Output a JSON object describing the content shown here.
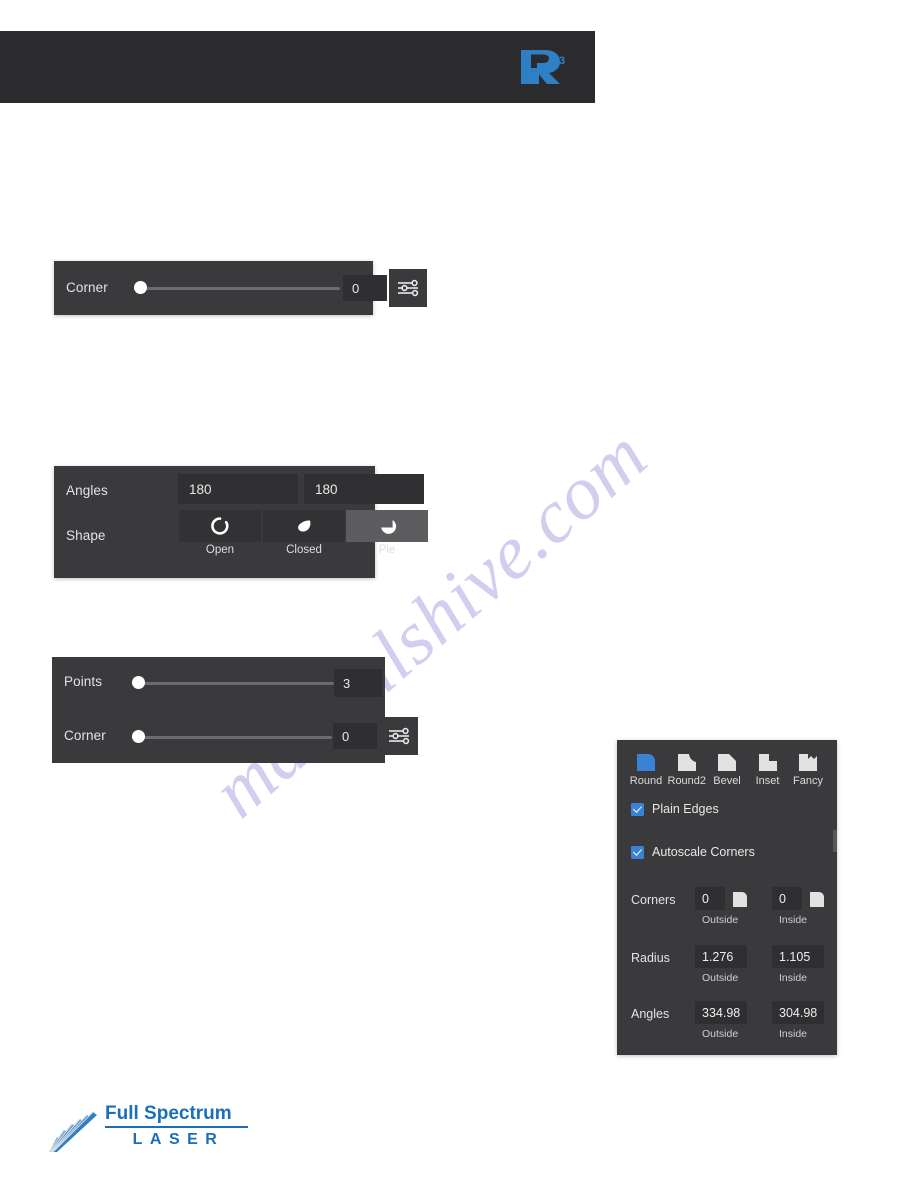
{
  "page": {
    "background": "#ffffff",
    "panel_bg": "#3a3a3c",
    "field_bg": "#2f2f31",
    "accent_blue": "#3a82d4",
    "brand_blue": "#1b6fb8"
  },
  "watermark": {
    "text": "manualshive.com",
    "color": "#c9c6ee"
  },
  "header": {
    "logo_name": "retinaengrave-r3-logo",
    "logo_text": "3",
    "background": "#2b2b2d"
  },
  "corner_panel": {
    "label": "Corner",
    "value": "0",
    "slider_position_percent": 0,
    "settings_icon": "sliders-icon"
  },
  "arc_panel": {
    "angles_label": "Angles",
    "angle_outside": "180",
    "angle_inside": "180",
    "shape_label": "Shape",
    "shapes": [
      {
        "name": "open-shape",
        "caption": "Open",
        "selected": false
      },
      {
        "name": "closed-shape",
        "caption": "Closed",
        "selected": false
      },
      {
        "name": "pie-shape",
        "caption": "Pie",
        "selected": true
      }
    ]
  },
  "star_panel": {
    "points_label": "Points",
    "points_value": "3",
    "points_slider_percent": 0,
    "corner_label": "Corner",
    "corner_value": "0",
    "corner_slider_percent": 0,
    "settings_icon": "sliders-icon"
  },
  "corners_panel": {
    "styles": [
      {
        "key": "round",
        "label": "Round",
        "selected": true
      },
      {
        "key": "round2",
        "label": "Round2",
        "selected": false
      },
      {
        "key": "bevel",
        "label": "Bevel",
        "selected": false
      },
      {
        "key": "inset",
        "label": "Inset",
        "selected": false
      },
      {
        "key": "fancy",
        "label": "Fancy",
        "selected": false
      }
    ],
    "plain_edges": {
      "label": "Plain Edges",
      "checked": true
    },
    "autoscale_corners": {
      "label": "Autoscale Corners",
      "checked": true
    },
    "rows": [
      {
        "label": "Corners",
        "outside_value": "0",
        "outside_sub": "Outside",
        "inside_value": "0",
        "inside_sub": "Inside",
        "has_preview_icon": true
      },
      {
        "label": "Radius",
        "outside_value": "1.276",
        "outside_sub": "Outside",
        "inside_value": "1.105",
        "inside_sub": "Inside",
        "has_preview_icon": false
      },
      {
        "label": "Angles",
        "outside_value": "334.98",
        "outside_sub": "Outside",
        "inside_value": "304.98",
        "inside_sub": "Inside",
        "has_preview_icon": false
      }
    ]
  },
  "footer": {
    "brand_top": "Full Spectrum",
    "brand_bottom": "LASER",
    "logo_name": "full-spectrum-laser-logo"
  }
}
